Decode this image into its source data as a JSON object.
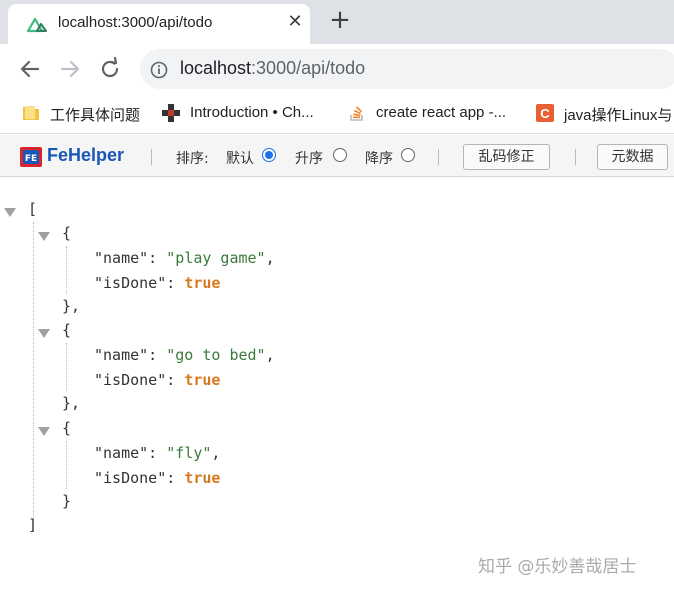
{
  "tab": {
    "title": "localhost:3000/api/todo",
    "close": "✕",
    "new_tab": "+"
  },
  "address": {
    "host": "localhost",
    "rest": ":3000/api/todo"
  },
  "bookmarks": [
    {
      "label": "工作具体问题",
      "icon": "folder-icon",
      "color": "#f5c342"
    },
    {
      "label": "Introduction • Ch...",
      "icon": "pixel-icon",
      "color": "#333333"
    },
    {
      "label": "create react app -...",
      "icon": "stackoverflow-icon",
      "color": "#f48024"
    },
    {
      "label": "java操作Linux与",
      "icon": "csdn-icon",
      "color": "#e85f34"
    }
  ],
  "fehelper": {
    "name": "FeHelper",
    "sort_label": "排序:",
    "default_label": "默认",
    "asc_label": "升序",
    "desc_label": "降序",
    "fix_button": "乱码修正",
    "meta_button": "元数据",
    "selected_sort": "默认"
  },
  "json": {
    "open_bracket": "[",
    "close_bracket": "]",
    "items": [
      {
        "name": "\"play game\"",
        "isDone": "true",
        "open": "{",
        "close": "},"
      },
      {
        "name": "\"go to bed\"",
        "isDone": "true",
        "open": "{",
        "close": "},"
      },
      {
        "name": "\"fly\"",
        "isDone": "true",
        "open": "{",
        "close": "}"
      }
    ],
    "name_key": "\"name\":",
    "isdone_key": "\"isDone\":",
    "comma": ","
  },
  "watermark": "知乎 @乐妙善哉居士",
  "colors": {
    "accent": "#1a73e8",
    "string": "#3a7a3a",
    "boolean": "#d77a1f",
    "fehelper_brand": "#1a56b8"
  }
}
